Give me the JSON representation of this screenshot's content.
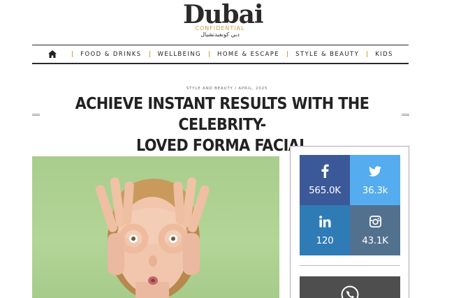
{
  "logo": {
    "main": "Dubai",
    "sub": "CONFIDENTIAL",
    "arabic": "دبي كونفيدنشيال"
  },
  "nav": {
    "home_icon": "home-icon",
    "items": [
      "FOOD & DRINKS",
      "WELLBEING",
      "HOME & ESCAPE",
      "STYLE & BEAUTY",
      "KIDS"
    ]
  },
  "article": {
    "meta": "STYLE AND BEAUTY / APRIL, 2025",
    "title_line1": "ACHIEVE INSTANT RESULTS WITH THE CELEBRITY-",
    "title_line2": "LOVED FORMA FACIAL"
  },
  "social": {
    "facebook": {
      "icon": "facebook-icon",
      "count": "565.0K",
      "color": "#3b5998"
    },
    "twitter": {
      "icon": "twitter-icon",
      "count": "36.3k",
      "color": "#55acee"
    },
    "linkedin": {
      "icon": "linkedin-icon",
      "count": "120",
      "color": "#2f7bb6"
    },
    "instagram": {
      "icon": "instagram-icon",
      "count": "43.1K",
      "color": "#52718f"
    },
    "whatsapp": {
      "icon": "whatsapp-icon"
    }
  },
  "colors": {
    "accent_gold": "#c9a14a",
    "text_dark": "#222222"
  }
}
